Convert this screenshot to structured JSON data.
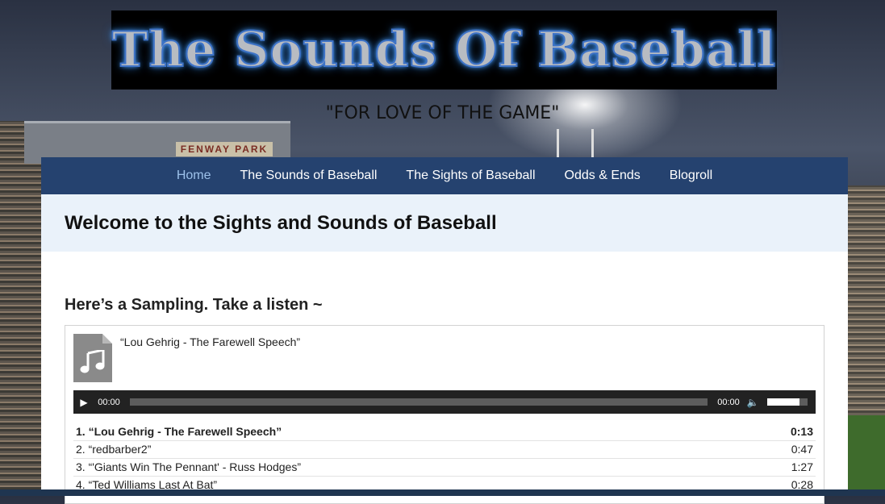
{
  "site": {
    "logo_text": "The Sounds Of Baseball",
    "tagline": "\"FOR LOVE OF THE GAME\"",
    "background_sign": "FENWAY PARK"
  },
  "nav": {
    "items": [
      {
        "label": "Home",
        "active": true
      },
      {
        "label": "The Sounds of Baseball",
        "active": false
      },
      {
        "label": "The Sights of Baseball",
        "active": false
      },
      {
        "label": "Odds & Ends",
        "active": false
      },
      {
        "label": "Blogroll",
        "active": false
      }
    ]
  },
  "page": {
    "title": "Welcome to the Sights and Sounds of Baseball",
    "section_heading": "Here’s a Sampling.  Take a listen ~"
  },
  "playlist": {
    "now_playing": "“Lou Gehrig - The Farewell Speech”",
    "thumb_icon": "music-note-icon",
    "player": {
      "current_time": "00:00",
      "duration": "00:00",
      "play_icon": "play-icon",
      "volume_icon": "volume-icon",
      "volume_level": 0.8
    },
    "tracks": [
      {
        "label": "1. “Lou Gehrig - The Farewell Speech”",
        "duration": "0:13",
        "current": true
      },
      {
        "label": "2. “redbarber2”",
        "duration": "0:47",
        "current": false
      },
      {
        "label": "3. “'Giants Win The Pennant' - Russ Hodges”",
        "duration": "1:27",
        "current": false
      },
      {
        "label": "4. “Ted Williams Last At Bat”",
        "duration": "0:28",
        "current": false
      }
    ]
  },
  "colors": {
    "nav_bg": "#25426f",
    "nav_active": "#9dc1ea",
    "title_band": "#eaf2fa",
    "player_bg": "#222222"
  }
}
